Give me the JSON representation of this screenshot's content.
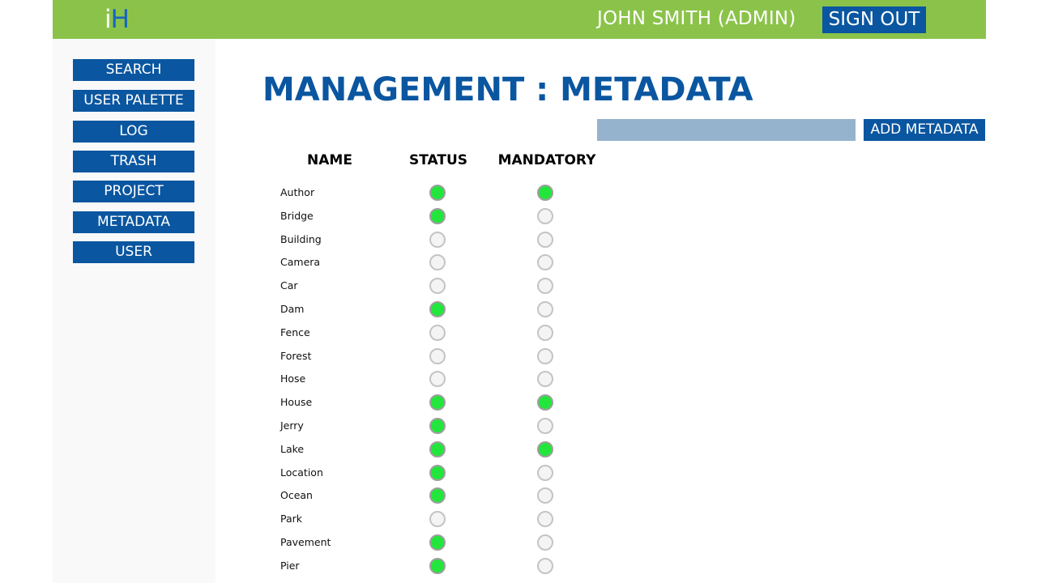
{
  "header": {
    "logo_i": "i",
    "logo_h": "H",
    "user_label": "JOHN SMITH (ADMIN)",
    "sign_out_label": "SIGN OUT"
  },
  "sidebar": {
    "items": [
      {
        "label": "SEARCH"
      },
      {
        "label": "USER PALETTE"
      },
      {
        "label": "LOG"
      },
      {
        "label": "TRASH"
      },
      {
        "label": "PROJECT"
      },
      {
        "label": "METADATA"
      },
      {
        "label": "USER"
      }
    ]
  },
  "main": {
    "title": "MANAGEMENT : METADATA",
    "input_value": "",
    "add_button_label": "ADD METADATA",
    "columns": {
      "name": "NAME",
      "status": "STATUS",
      "mandatory": "MANDATORY"
    },
    "rows": [
      {
        "name": "Author",
        "status": true,
        "mandatory": true
      },
      {
        "name": "Bridge",
        "status": true,
        "mandatory": false
      },
      {
        "name": "Building",
        "status": false,
        "mandatory": false
      },
      {
        "name": "Camera",
        "status": false,
        "mandatory": false
      },
      {
        "name": "Car",
        "status": false,
        "mandatory": false
      },
      {
        "name": "Dam",
        "status": true,
        "mandatory": false
      },
      {
        "name": "Fence",
        "status": false,
        "mandatory": false
      },
      {
        "name": "Forest",
        "status": false,
        "mandatory": false
      },
      {
        "name": "Hose",
        "status": false,
        "mandatory": false
      },
      {
        "name": "House",
        "status": true,
        "mandatory": true
      },
      {
        "name": "Jerry",
        "status": true,
        "mandatory": false
      },
      {
        "name": "Lake",
        "status": true,
        "mandatory": true
      },
      {
        "name": "Location",
        "status": true,
        "mandatory": false
      },
      {
        "name": "Ocean",
        "status": true,
        "mandatory": false
      },
      {
        "name": "Park",
        "status": false,
        "mandatory": false
      },
      {
        "name": "Pavement",
        "status": true,
        "mandatory": false
      },
      {
        "name": "Pier",
        "status": true,
        "mandatory": false
      }
    ]
  },
  "colors": {
    "header_green": "#8bc34a",
    "primary_blue": "#0a56a0",
    "radio_on_green": "#22e63c",
    "radio_off_border": "#c4c4c4",
    "input_bg": "#95b3cc",
    "sidebar_bg": "#f9f9f9"
  }
}
